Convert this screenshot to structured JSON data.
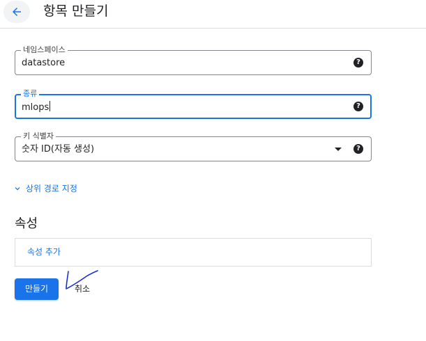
{
  "header": {
    "title": "항목 만들기",
    "back_icon": "arrow-back-icon"
  },
  "form": {
    "namespace": {
      "label": "네임스페이스",
      "value": "datastore"
    },
    "kind": {
      "label": "종류",
      "value": "mlops"
    },
    "key_identifier": {
      "label": "키 식별자",
      "value": "숫자 ID(자동 생성)"
    },
    "ancestor_link": "상위 경로 지정"
  },
  "properties": {
    "title": "속성",
    "add_label": "속성 추가"
  },
  "actions": {
    "create_label": "만들기",
    "cancel_label": "취소"
  },
  "colors": {
    "accent": "#1a73e8",
    "scribble": "#1a2fd6"
  }
}
